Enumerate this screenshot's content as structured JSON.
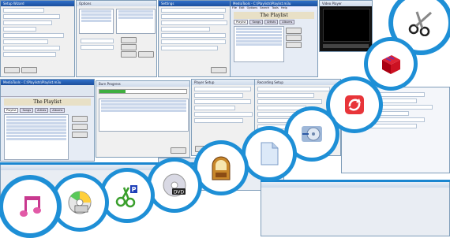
{
  "screenshots": {
    "ss1": {
      "title": "Setup Wizard"
    },
    "ss2": {
      "title": "Options"
    },
    "ss3": {
      "title": "Settings"
    },
    "ss4": {
      "title": "Preferences"
    },
    "ss5": {
      "title": "MediaTools - C:\\Playlists\\Playlist.m3u",
      "heading": "The Playlist",
      "menu": [
        "File",
        "Edit",
        "Options",
        "Search",
        "Tools",
        "Help"
      ],
      "tabs": [
        "Playlist",
        "Songs",
        "Artists",
        "Albums"
      ]
    },
    "ss6": {
      "title": "Video Player"
    },
    "ss7": {
      "title": "MediaTools - C:\\Playlists\\Playlist.m3u",
      "heading": "The Playlist",
      "tabs": [
        "Playlist",
        "Songs",
        "Artists",
        "Albums"
      ]
    },
    "ss8": {
      "title": "Burn Progress"
    },
    "ss9": {
      "title": "Player Setup"
    },
    "ss10": {
      "title": "Recording Setup"
    }
  },
  "icons": [
    {
      "name": "scissors-icon"
    },
    {
      "name": "red-cube-icon"
    },
    {
      "name": "red-refresh-icon"
    },
    {
      "name": "disc-arrow-icon"
    },
    {
      "name": "blank-document-icon"
    },
    {
      "name": "jukebox-icon"
    },
    {
      "name": "dvd-disc-icon"
    },
    {
      "name": "scissors-p-icon"
    },
    {
      "name": "cd-rainbow-icon"
    },
    {
      "name": "pink-music-icon"
    }
  ],
  "colors": {
    "circle": "#1e8fd6",
    "titlebar": "#2f6fc9"
  }
}
